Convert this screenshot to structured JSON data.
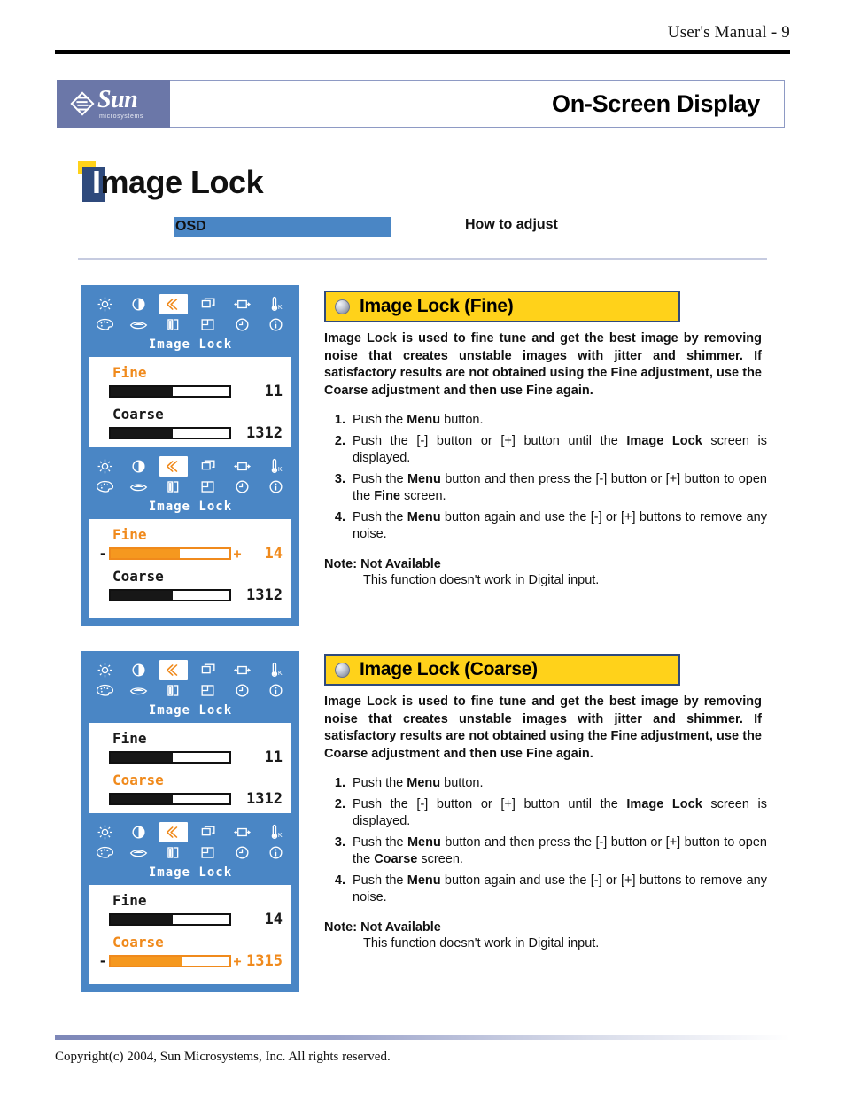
{
  "header": {
    "manual_label": "User's Manual - 9",
    "brand_name": "Sun",
    "brand_sub": "microsystems",
    "section_title": "On-Screen Display"
  },
  "page_title": {
    "initial": "I",
    "rest": "mage Lock"
  },
  "columns": {
    "osd": "OSD",
    "how": "How to adjust"
  },
  "osd_common": {
    "menu_label": "Image Lock",
    "fine_label": "Fine",
    "coarse_label": "Coarse",
    "minus": "-",
    "plus": "+",
    "icons_row1": [
      "brightness-icon",
      "contrast-icon",
      "image-lock-icon",
      "position-icon",
      "size-icon",
      "color-temp-icon"
    ],
    "icons_row2": [
      "color-palette-icon",
      "gamma-icon",
      "image-lock-bars-icon",
      "osd-position-icon",
      "timer-icon",
      "information-icon"
    ],
    "accent_color": "#f08a1c",
    "screen_bg": "#4a86c5"
  },
  "osd_screens": [
    {
      "name": "image-lock-fine-idle",
      "fine": {
        "label": "Fine",
        "value": "11",
        "fill_pct": 52,
        "active": false,
        "highlight": true
      },
      "coarse": {
        "label": "Coarse",
        "value": "1312",
        "fill_pct": 52,
        "active": false,
        "highlight": false
      }
    },
    {
      "name": "image-lock-fine-adjust",
      "fine": {
        "label": "Fine",
        "value": "14",
        "fill_pct": 58,
        "active": true,
        "highlight": true
      },
      "coarse": {
        "label": "Coarse",
        "value": "1312",
        "fill_pct": 52,
        "active": false,
        "highlight": false
      }
    },
    {
      "name": "image-lock-coarse-idle",
      "fine": {
        "label": "Fine",
        "value": "11",
        "fill_pct": 52,
        "active": false,
        "highlight": false
      },
      "coarse": {
        "label": "Coarse",
        "value": "1312",
        "fill_pct": 52,
        "active": false,
        "highlight": true
      }
    },
    {
      "name": "image-lock-coarse-adjust",
      "fine": {
        "label": "Fine",
        "value": "14",
        "fill_pct": 52,
        "active": false,
        "highlight": false
      },
      "coarse": {
        "label": "Coarse",
        "value": "1315",
        "fill_pct": 60,
        "active": true,
        "highlight": true
      }
    }
  ],
  "sections": [
    {
      "banner_title": "Image Lock (Fine)",
      "blurb": "Image Lock is used to fine tune and get the best image by removing noise that creates unstable images with jitter and shimmer. If satisfactory results are not obtained using the Fine adjustment, use the Coarse adjustment and then use Fine again.",
      "steps": [
        {
          "num": "1.",
          "html": "Push the <b>Menu</b> button."
        },
        {
          "num": "2.",
          "html": "Push the [-] button or [+] button until the <b>Image Lock</b> screen is displayed."
        },
        {
          "num": "3.",
          "html": "Push the <b>Menu</b> button and then press the [-] button or [+] button to open the <b>Fine</b> screen."
        },
        {
          "num": "4.",
          "html": "Push the <b>Menu</b> button again and use the [-] or [+] buttons to remove any noise."
        }
      ],
      "note_head": "Note: Not Available",
      "note_body": "This function doesn't work in Digital input."
    },
    {
      "banner_title": "Image Lock (Coarse)",
      "blurb": "Image Lock is used to fine tune and get the best image by removing noise that creates unstable images with jitter and shimmer. If satisfactory results are not obtained using the Fine adjustment, use the Coarse adjustment and then use Fine again.",
      "steps": [
        {
          "num": "1.",
          "html": "Push the <b>Menu</b> button."
        },
        {
          "num": "2.",
          "html": "Push the [-] button or [+] button until the <b>Image Lock</b> screen is displayed."
        },
        {
          "num": "3.",
          "html": "Push the <b>Menu</b> button and then press the [-] button or [+] button to open the <b>Coarse</b> screen."
        },
        {
          "num": "4.",
          "html": "Push the <b>Menu</b> button again and use the [-] or [+] buttons to remove any noise."
        }
      ],
      "note_head": "Note: Not Available",
      "note_body": "This function doesn't work in Digital input."
    }
  ],
  "footer": {
    "copyright": "Copyright(c) 2004, Sun Microsystems, Inc. All rights reserved."
  }
}
